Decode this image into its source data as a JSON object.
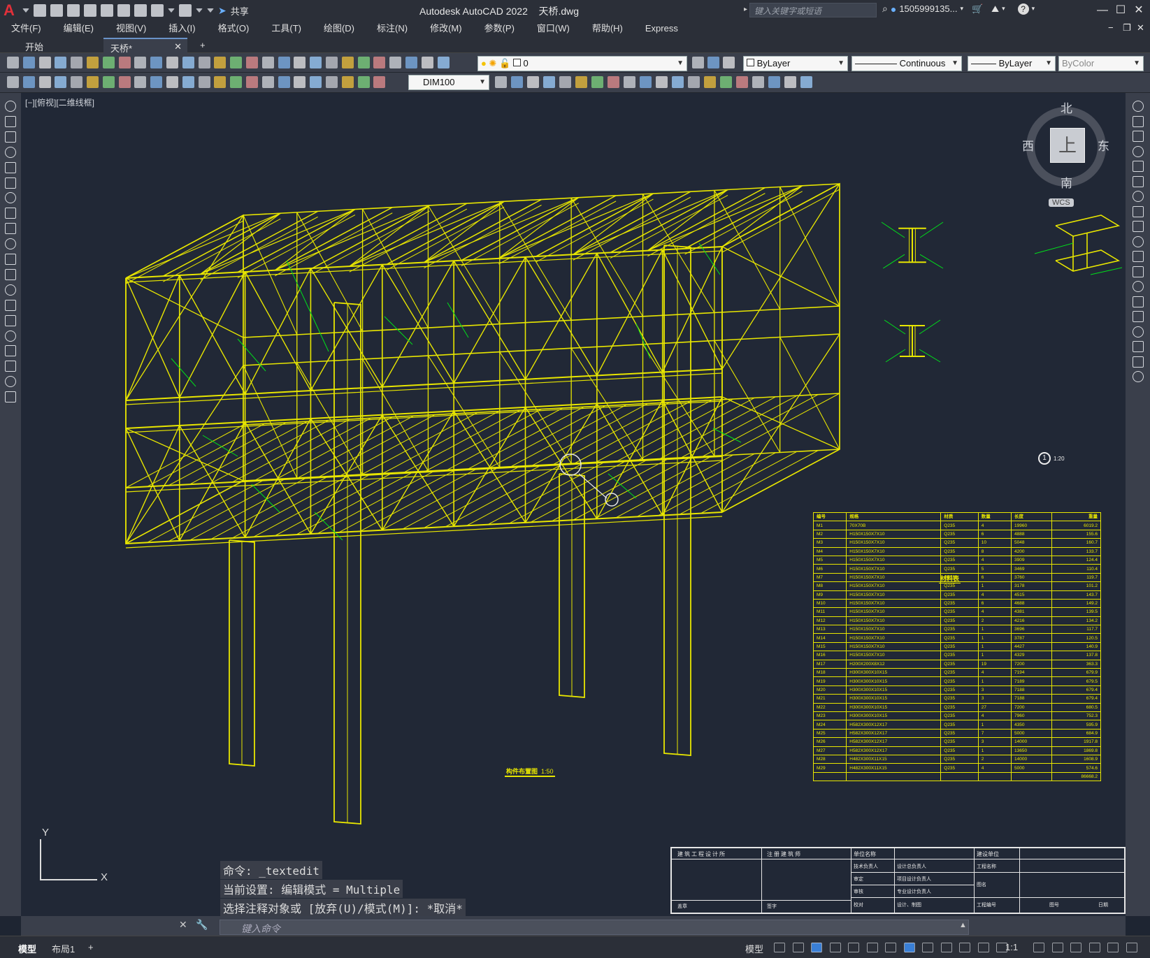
{
  "app": {
    "title": "Autodesk AutoCAD 2022",
    "filename": "天桥.dwg",
    "search_placeholder": "键入关键字或短语",
    "user": "1505999135...",
    "share": "共享",
    "logo": "A"
  },
  "menu": [
    "文件(F)",
    "编辑(E)",
    "视图(V)",
    "插入(I)",
    "格式(O)",
    "工具(T)",
    "绘图(D)",
    "标注(N)",
    "修改(M)",
    "参数(P)",
    "窗口(W)",
    "帮助(H)",
    "Express"
  ],
  "tabs": {
    "start": "开始",
    "active": "天桥*",
    "add": "+"
  },
  "props": {
    "layer": "0",
    "color": "ByLayer",
    "linetype": "Continuous",
    "lineweight": "ByLayer",
    "plotstyle": "ByColor",
    "dimstyle": "DIM100"
  },
  "viewport": {
    "label": "[−][俯视][二维线框]",
    "viewcube": {
      "north": "北",
      "south": "南",
      "east": "东",
      "west": "西",
      "top": "上",
      "wcs": "WCS"
    },
    "ucs": {
      "y": "Y",
      "x": "X"
    }
  },
  "drawing": {
    "plan_title": "构件布置图",
    "plan_scale": "1:50",
    "table_title": "材料表",
    "detail_scale": "1:20",
    "detail_num": "1"
  },
  "material_table": {
    "headers": [
      "编号",
      "规格",
      "材质",
      "数量",
      "长度",
      "重量"
    ],
    "rows": [
      [
        "M1",
        "70X70B",
        "Q235",
        "4",
        "19960",
        "6019.2"
      ],
      [
        "M2",
        "H150X150X7X10",
        "Q235",
        "6",
        "4888",
        "155.6"
      ],
      [
        "M3",
        "H150X150X7X10",
        "Q235",
        "10",
        "5048",
        "160.7"
      ],
      [
        "M4",
        "H150X150X7X10",
        "Q235",
        "8",
        "4200",
        "133.7"
      ],
      [
        "M5",
        "H150X150X7X10",
        "Q235",
        "4",
        "3909",
        "124.4"
      ],
      [
        "M6",
        "H150X150X7X10",
        "Q235",
        "5",
        "3469",
        "110.4"
      ],
      [
        "M7",
        "H150X150X7X10",
        "Q235",
        "6",
        "3760",
        "119.7"
      ],
      [
        "M8",
        "H150X150X7X10",
        "Q235",
        "1",
        "3178",
        "101.2"
      ],
      [
        "M9",
        "H150X150X7X10",
        "Q235",
        "4",
        "4515",
        "143.7"
      ],
      [
        "M10",
        "H150X150X7X10",
        "Q235",
        "6",
        "4688",
        "149.2"
      ],
      [
        "M11",
        "H150X150X7X10",
        "Q235",
        "4",
        "4381",
        "139.5"
      ],
      [
        "M12",
        "H150X150X7X10",
        "Q235",
        "2",
        "4216",
        "134.2"
      ],
      [
        "M13",
        "H150X150X7X10",
        "Q235",
        "1",
        "3696",
        "117.7"
      ],
      [
        "M14",
        "H150X150X7X10",
        "Q235",
        "1",
        "3787",
        "120.5"
      ],
      [
        "M15",
        "H150X150X7X10",
        "Q235",
        "1",
        "4427",
        "140.9"
      ],
      [
        "M16",
        "H150X150X7X10",
        "Q235",
        "1",
        "4329",
        "137.8"
      ],
      [
        "M17",
        "H200X200X8X12",
        "Q235",
        "19",
        "7200",
        "363.3"
      ],
      [
        "M18",
        "H300X300X10X15",
        "Q235",
        "4",
        "7194",
        "679.9"
      ],
      [
        "M19",
        "H300X300X10X15",
        "Q235",
        "1",
        "7189",
        "679.5"
      ],
      [
        "M20",
        "H300X300X10X15",
        "Q235",
        "3",
        "7188",
        "679.4"
      ],
      [
        "M21",
        "H300X300X10X15",
        "Q235",
        "3",
        "7188",
        "679.4"
      ],
      [
        "M22",
        "H300X300X10X15",
        "Q235",
        "27",
        "7200",
        "680.5"
      ],
      [
        "M23",
        "H300X300X10X15",
        "Q235",
        "4",
        "7960",
        "752.3"
      ],
      [
        "M24",
        "H582X300X12X17",
        "Q235",
        "1",
        "4350",
        "595.9"
      ],
      [
        "M25",
        "H582X300X12X17",
        "Q235",
        "7",
        "5000",
        "684.9"
      ],
      [
        "M26",
        "H582X300X12X17",
        "Q235",
        "3",
        "14000",
        "1917.8"
      ],
      [
        "M27",
        "H582X300X12X17",
        "Q235",
        "1",
        "13650",
        "1869.8"
      ],
      [
        "M28",
        "H482X300X11X15",
        "Q235",
        "2",
        "14000",
        "1608.9"
      ],
      [
        "M29",
        "H482X300X11X15",
        "Q235",
        "4",
        "5000",
        "574.6"
      ]
    ],
    "total": "86668.2"
  },
  "title_block": {
    "c1": "建筑工程设计所",
    "c2": "注册建筑师",
    "c3": "单位名称",
    "c4": "建设单位",
    "r1": "技术负责人",
    "r1b": "设计总负责人",
    "r1c": "工程名称",
    "r2": "审定",
    "r2b": "项目设计负责人",
    "r3": "审核",
    "r3b": "专业设计负责人",
    "r3c": "图名",
    "r4a": "盖章",
    "r4b": "签字",
    "r4c": "校对",
    "r4d": "设计、制图",
    "r4e": "工程编号",
    "r4f": "图号",
    "r4g": "日期"
  },
  "command": {
    "line1": "命令: _textedit",
    "line2": "当前设置: 编辑模式 = Multiple",
    "line3": "选择注释对象或 [放弃(U)/模式(M)]: *取消*",
    "placeholder": "键入命令"
  },
  "status": {
    "model_tab": "模型",
    "layout_tab": "布局1",
    "model_btn": "模型",
    "scale": "1:1"
  },
  "colors": {
    "drawing_bg": "#212836",
    "structure": "#e8e600",
    "annotation": "#00e01a",
    "accent": "#3a7fd6"
  }
}
